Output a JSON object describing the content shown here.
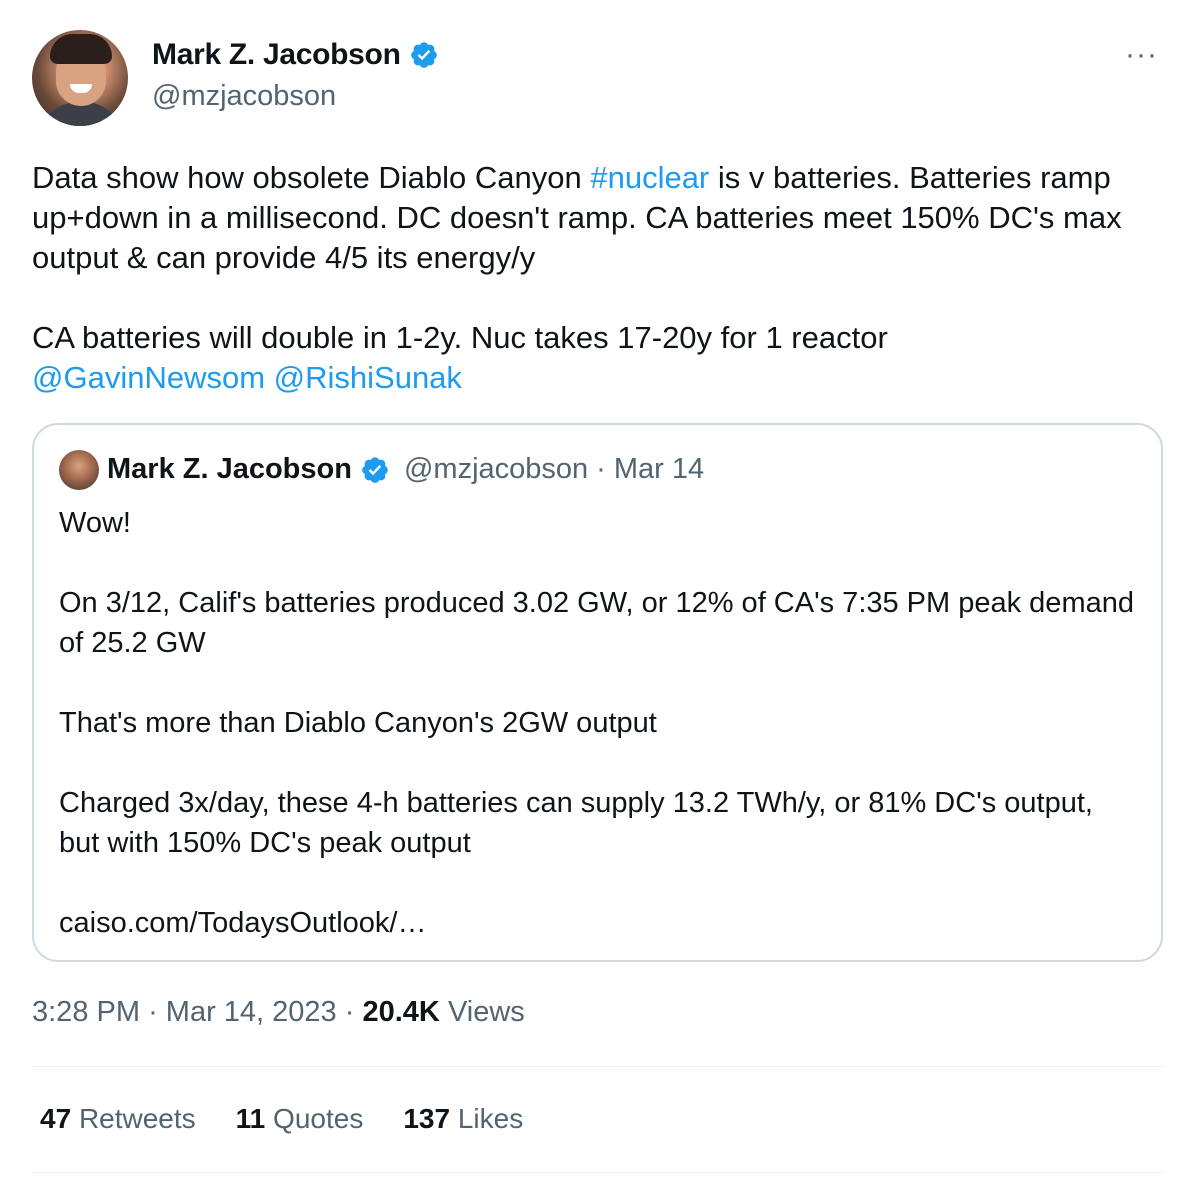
{
  "author": {
    "display_name": "Mark Z. Jacobson",
    "handle": "@mzjacobson",
    "verified": true
  },
  "tweet": {
    "text_part1": "Data show how obsolete Diablo Canyon ",
    "hashtag": "#nuclear",
    "text_part2": " is v batteries. Batteries ramp up+down in a millisecond. DC doesn't ramp. CA batteries meet 150% DC's max output & can provide 4/5 its energy/y\n\nCA batteries will double in 1-2y. Nuc takes 17-20y for 1 reactor\n",
    "mention1": "@GavinNewsom",
    "mention2": "@RishiSunak"
  },
  "quoted_tweet": {
    "display_name": "Mark Z. Jacobson",
    "handle": "@mzjacobson",
    "separator": "·",
    "date": "Mar 14",
    "text": "Wow!\n\nOn 3/12, Calif's batteries produced 3.02 GW, or 12% of CA's 7:35 PM peak demand of 25.2 GW\n\nThat's more than Diablo Canyon's 2GW output\n\nCharged 3x/day, these 4-h batteries can supply 13.2 TWh/y, or 81% DC's output, but with 150% DC's peak output\n\ncaiso.com/TodaysOutlook/…"
  },
  "meta": {
    "time": "3:28 PM",
    "date": "Mar 14, 2023",
    "sep": "·",
    "views_count": "20.4K",
    "views_label": "Views"
  },
  "stats": {
    "retweets_count": "47",
    "retweets_label": "Retweets",
    "quotes_count": "11",
    "quotes_label": "Quotes",
    "likes_count": "137",
    "likes_label": "Likes"
  },
  "menu": {
    "more_label": "···"
  },
  "colors": {
    "link": "#1d9bf0",
    "secondary_text": "#536471",
    "primary_text": "#0f1419",
    "border": "#cfd9de"
  },
  "icons": {
    "verified": "verified-badge-icon",
    "more": "more-options-icon"
  }
}
